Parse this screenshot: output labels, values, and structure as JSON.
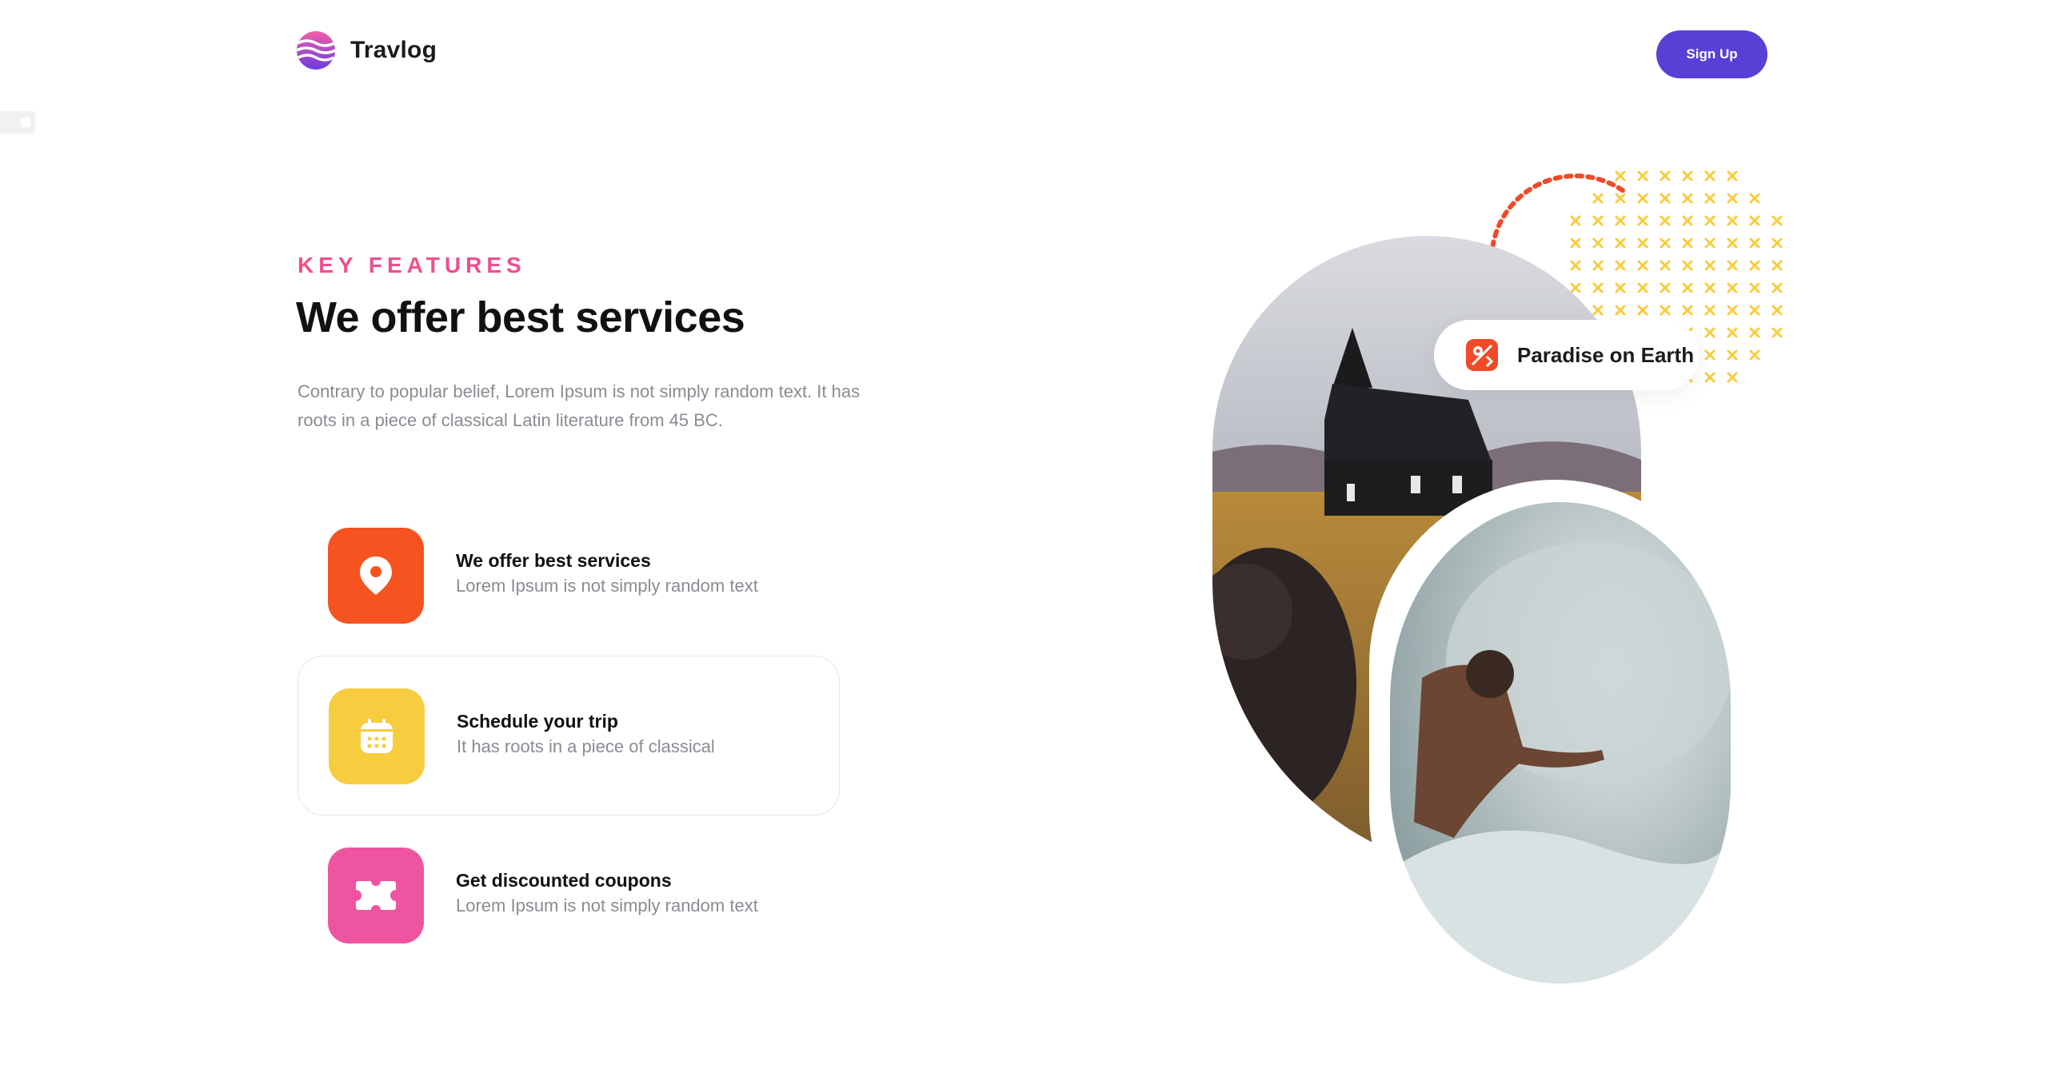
{
  "header": {
    "brand": "Travlog",
    "signup_label": "Sign Up"
  },
  "hero": {
    "eyebrow": "KEY FEATURES",
    "title": "We offer best services",
    "intro": "Contrary to popular belief, Lorem Ipsum is not simply random text. It has roots in a piece of classical Latin literature from 45 BC."
  },
  "features": [
    {
      "title": "We offer best services",
      "desc": "Lorem Ipsum is not simply random text",
      "icon": "location-pin-icon",
      "color": "#f5531f"
    },
    {
      "title": "Schedule your trip",
      "desc": "It has roots in a piece of classical",
      "icon": "calendar-icon",
      "color": "#f8cc3f"
    },
    {
      "title": "Get discounted coupons",
      "desc": "Lorem Ipsum is not simply random text",
      "icon": "ticket-icon",
      "color": "#ef54a0"
    }
  ],
  "visual": {
    "badge_label": "Paradise on Earth",
    "badge_icon": "map-pin-tag-icon"
  },
  "colors": {
    "accent": "#5a3fd6",
    "eyebrow": "#ef4f8f",
    "orange": "#f5531f",
    "yellow": "#f8cc3f",
    "pink": "#ef54a0"
  }
}
